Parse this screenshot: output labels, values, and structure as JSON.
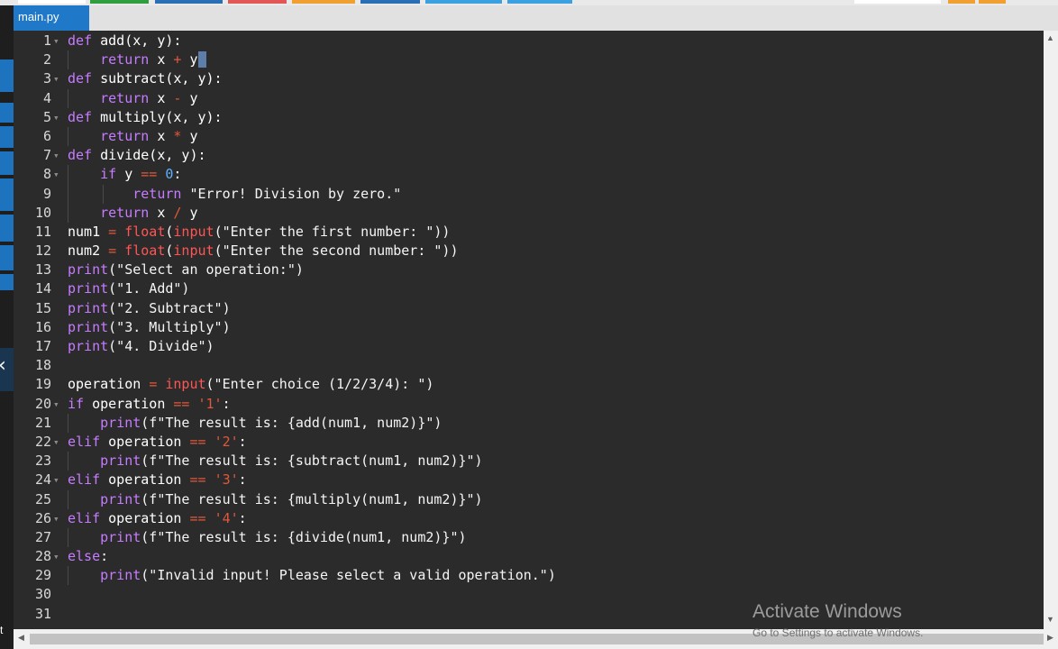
{
  "tab": {
    "filename": "main.py"
  },
  "left_sidebar": {
    "collapse_glyph": "‹",
    "partial_char": "t"
  },
  "watermark": {
    "title": "Activate Windows",
    "subtitle": "Go to Settings to activate Windows."
  },
  "colors": {
    "keyword": "#c67cff",
    "builtin": "#ff5555",
    "operator": "#e0583c",
    "number": "#5fb0ff",
    "tab_active": "#1f78c8",
    "editor_bg": "#2b2b2b"
  },
  "code_lines": [
    {
      "n": "1",
      "fold": true,
      "indent": 0,
      "tokens": [
        [
          "kw",
          "def "
        ],
        [
          "fn",
          "add(x, y):"
        ]
      ]
    },
    {
      "n": "2",
      "fold": false,
      "indent": 1,
      "tokens": [
        [
          "kw",
          "return "
        ],
        [
          "fn",
          "x "
        ],
        [
          "op",
          "+ "
        ],
        [
          "fn",
          "y"
        ],
        [
          "cursor",
          " "
        ]
      ]
    },
    {
      "n": "3",
      "fold": true,
      "indent": 0,
      "tokens": [
        [
          "kw",
          "def "
        ],
        [
          "fn",
          "subtract(x, y):"
        ]
      ]
    },
    {
      "n": "4",
      "fold": false,
      "indent": 1,
      "tokens": [
        [
          "kw",
          "return "
        ],
        [
          "fn",
          "x "
        ],
        [
          "op",
          "- "
        ],
        [
          "fn",
          "y"
        ]
      ]
    },
    {
      "n": "5",
      "fold": true,
      "indent": 0,
      "tokens": [
        [
          "kw",
          "def "
        ],
        [
          "fn",
          "multiply(x, y):"
        ]
      ]
    },
    {
      "n": "6",
      "fold": false,
      "indent": 1,
      "tokens": [
        [
          "kw",
          "return "
        ],
        [
          "fn",
          "x "
        ],
        [
          "op",
          "* "
        ],
        [
          "fn",
          "y"
        ]
      ]
    },
    {
      "n": "7",
      "fold": true,
      "indent": 0,
      "tokens": [
        [
          "kw",
          "def "
        ],
        [
          "fn",
          "divide(x, y):"
        ]
      ]
    },
    {
      "n": "8",
      "fold": true,
      "indent": 1,
      "tokens": [
        [
          "kw",
          "if "
        ],
        [
          "fn",
          "y "
        ],
        [
          "op",
          "== "
        ],
        [
          "num",
          "0"
        ],
        [
          "fn",
          ":"
        ]
      ]
    },
    {
      "n": "9",
      "fold": false,
      "indent": 2,
      "tokens": [
        [
          "kw",
          "return "
        ],
        [
          "str",
          "\"Error! Division by zero.\""
        ]
      ]
    },
    {
      "n": "10",
      "fold": false,
      "indent": 1,
      "tokens": [
        [
          "kw",
          "return "
        ],
        [
          "fn",
          "x "
        ],
        [
          "op",
          "/ "
        ],
        [
          "fn",
          "y"
        ]
      ]
    },
    {
      "n": "11",
      "fold": false,
      "indent": 0,
      "tokens": [
        [
          "fn",
          "num1 "
        ],
        [
          "op",
          "= "
        ],
        [
          "bi",
          "float"
        ],
        [
          "fn",
          "("
        ],
        [
          "bi",
          "input"
        ],
        [
          "str",
          "(\"Enter the first number: \"))"
        ]
      ]
    },
    {
      "n": "12",
      "fold": false,
      "indent": 0,
      "tokens": [
        [
          "fn",
          "num2 "
        ],
        [
          "op",
          "= "
        ],
        [
          "bi",
          "float"
        ],
        [
          "fn",
          "("
        ],
        [
          "bi",
          "input"
        ],
        [
          "str",
          "(\"Enter the second number: \"))"
        ]
      ]
    },
    {
      "n": "13",
      "fold": false,
      "indent": 0,
      "tokens": [
        [
          "kw",
          "print"
        ],
        [
          "str",
          "(\"Select an operation:\")"
        ]
      ]
    },
    {
      "n": "14",
      "fold": false,
      "indent": 0,
      "tokens": [
        [
          "kw",
          "print"
        ],
        [
          "str",
          "(\"1. Add\")"
        ]
      ]
    },
    {
      "n": "15",
      "fold": false,
      "indent": 0,
      "tokens": [
        [
          "kw",
          "print"
        ],
        [
          "str",
          "(\"2. Subtract\")"
        ]
      ]
    },
    {
      "n": "16",
      "fold": false,
      "indent": 0,
      "tokens": [
        [
          "kw",
          "print"
        ],
        [
          "str",
          "(\"3. Multiply\")"
        ]
      ]
    },
    {
      "n": "17",
      "fold": false,
      "indent": 0,
      "tokens": [
        [
          "kw",
          "print"
        ],
        [
          "str",
          "(\"4. Divide\")"
        ]
      ]
    },
    {
      "n": "18",
      "fold": false,
      "indent": 0,
      "tokens": []
    },
    {
      "n": "19",
      "fold": false,
      "indent": 0,
      "tokens": [
        [
          "fn",
          "operation "
        ],
        [
          "op",
          "= "
        ],
        [
          "bi",
          "input"
        ],
        [
          "str",
          "(\"Enter choice (1/2/3/4): \")"
        ]
      ]
    },
    {
      "n": "20",
      "fold": true,
      "indent": 0,
      "tokens": [
        [
          "kw",
          "if "
        ],
        [
          "fn",
          "operation "
        ],
        [
          "op",
          "== "
        ],
        [
          "op",
          "'1'"
        ],
        [
          "fn",
          ":"
        ]
      ]
    },
    {
      "n": "21",
      "fold": false,
      "indent": 1,
      "tokens": [
        [
          "kw",
          "print"
        ],
        [
          "str",
          "(f\"The result is: {add(num1, num2)}\")"
        ]
      ]
    },
    {
      "n": "22",
      "fold": true,
      "indent": 0,
      "tokens": [
        [
          "kw",
          "elif "
        ],
        [
          "fn",
          "operation "
        ],
        [
          "op",
          "== "
        ],
        [
          "op",
          "'2'"
        ],
        [
          "fn",
          ":"
        ]
      ]
    },
    {
      "n": "23",
      "fold": false,
      "indent": 1,
      "tokens": [
        [
          "kw",
          "print"
        ],
        [
          "str",
          "(f\"The result is: {subtract(num1, num2)}\")"
        ]
      ]
    },
    {
      "n": "24",
      "fold": true,
      "indent": 0,
      "tokens": [
        [
          "kw",
          "elif "
        ],
        [
          "fn",
          "operation "
        ],
        [
          "op",
          "== "
        ],
        [
          "op",
          "'3'"
        ],
        [
          "fn",
          ":"
        ]
      ]
    },
    {
      "n": "25",
      "fold": false,
      "indent": 1,
      "tokens": [
        [
          "kw",
          "print"
        ],
        [
          "str",
          "(f\"The result is: {multiply(num1, num2)}\")"
        ]
      ]
    },
    {
      "n": "26",
      "fold": true,
      "indent": 0,
      "tokens": [
        [
          "kw",
          "elif "
        ],
        [
          "fn",
          "operation "
        ],
        [
          "op",
          "== "
        ],
        [
          "op",
          "'4'"
        ],
        [
          "fn",
          ":"
        ]
      ]
    },
    {
      "n": "27",
      "fold": false,
      "indent": 1,
      "tokens": [
        [
          "kw",
          "print"
        ],
        [
          "str",
          "(f\"The result is: {divide(num1, num2)}\")"
        ]
      ]
    },
    {
      "n": "28",
      "fold": true,
      "indent": 0,
      "tokens": [
        [
          "kw",
          "else"
        ],
        [
          "fn",
          ":"
        ]
      ]
    },
    {
      "n": "29",
      "fold": false,
      "indent": 1,
      "tokens": [
        [
          "kw",
          "print"
        ],
        [
          "str",
          "(\"Invalid input! Please select a valid operation.\")"
        ]
      ]
    },
    {
      "n": "30",
      "fold": false,
      "indent": 0,
      "tokens": []
    },
    {
      "n": "31",
      "fold": false,
      "indent": 0,
      "tokens": []
    }
  ]
}
